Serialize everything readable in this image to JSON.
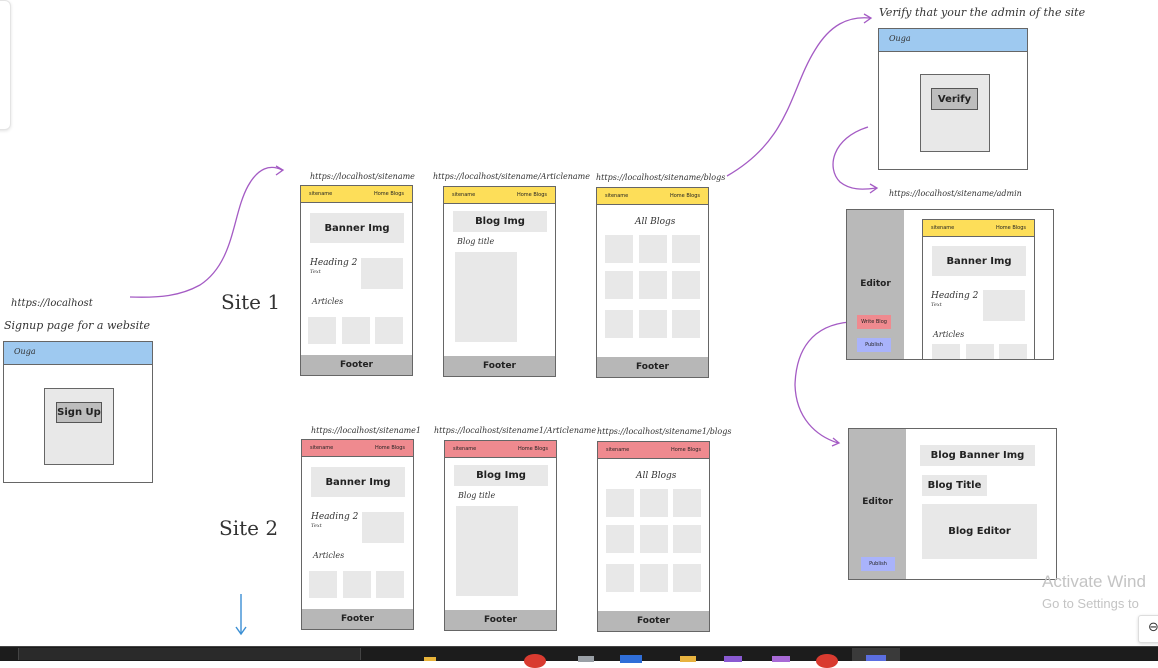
{
  "signup": {
    "url": "https://localhost",
    "caption": "Signup page for a website",
    "header": "Ouga",
    "button": "Sign Up"
  },
  "verify": {
    "caption": "Verify that your the admin of the site",
    "header": "Ouga",
    "button": "Verify"
  },
  "sites": {
    "site1": "Site 1",
    "site2": "Site 2"
  },
  "site1": {
    "urls": [
      "https://localhost/sitename",
      "https://localhost/sitename/Articlename",
      "https://localhost/sitename/blogs"
    ]
  },
  "site2": {
    "urls": [
      "https://localhost/sitename1",
      "https://localhost/sitename1/Articlename",
      "https://localhost/sitename1/blogs"
    ]
  },
  "page": {
    "nav_name": "sitename",
    "nav_links": "Home  Blogs",
    "banner": "Banner Img",
    "heading": "Heading 2",
    "text": "Text",
    "articles": "Articles",
    "footer": "Footer",
    "blog_img": "Blog Img",
    "blog_title": "Blog title",
    "all_blogs": "All Blogs"
  },
  "admin": {
    "url": "https://localhost/sitename/admin",
    "editor_label": "Editor",
    "write_blog": "Write Blog",
    "publish": "Publish"
  },
  "editor2": {
    "label": "Editor",
    "blog_banner": "Blog Banner Img",
    "blog_title": "Blog Title",
    "blog_editor": "Blog Editor",
    "publish": "Publish"
  },
  "watermark": {
    "line1": "Activate Wind",
    "line2": "Go to Settings to"
  },
  "colors": {
    "signup_header": "#9ec9f0",
    "site1_nav": "#fdde59",
    "site2_nav": "#ef8a8f",
    "write_blog": "#ef8a8f",
    "publish": "#a9b3fb",
    "arrow": "#a45bc4",
    "down_arrow": "#3b8fd4"
  }
}
